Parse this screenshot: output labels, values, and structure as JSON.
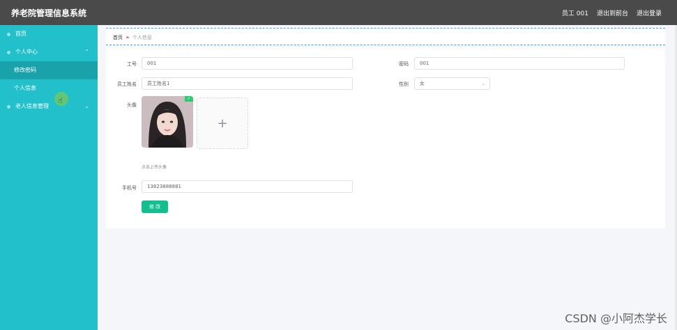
{
  "header": {
    "title": "养老院管理信息系统",
    "user": "员工 001",
    "exit_backend": "退出到前台",
    "logout": "退出登录"
  },
  "sidebar": {
    "items": [
      {
        "label": "首页"
      },
      {
        "label": "个人中心",
        "expanded": true,
        "children": [
          {
            "label": "修改密码",
            "active": true
          },
          {
            "label": "个人信息"
          }
        ]
      },
      {
        "label": "老人信息管理",
        "expanded": false
      }
    ]
  },
  "breadcrumb": {
    "home": "首页",
    "current": "个人信息"
  },
  "form": {
    "employee_id": {
      "label": "工号",
      "value": "001"
    },
    "password": {
      "label": "密码",
      "value": "001"
    },
    "employee_name": {
      "label": "员工姓名",
      "value": "员工姓名1"
    },
    "gender": {
      "label": "性别",
      "value": "女"
    },
    "avatar": {
      "label": "头像",
      "hint": "点击上传头像",
      "plus": "+"
    },
    "phone": {
      "label": "手机号",
      "value": "13823888881"
    },
    "submit_label": "修 改"
  },
  "watermark": "CSDN @小阿杰学长",
  "colors": {
    "topbar": "#4a4a4a",
    "sidebar": "#21c0ca",
    "sidebar_active": "#1aa2ab",
    "submit": "#13bf8f"
  }
}
